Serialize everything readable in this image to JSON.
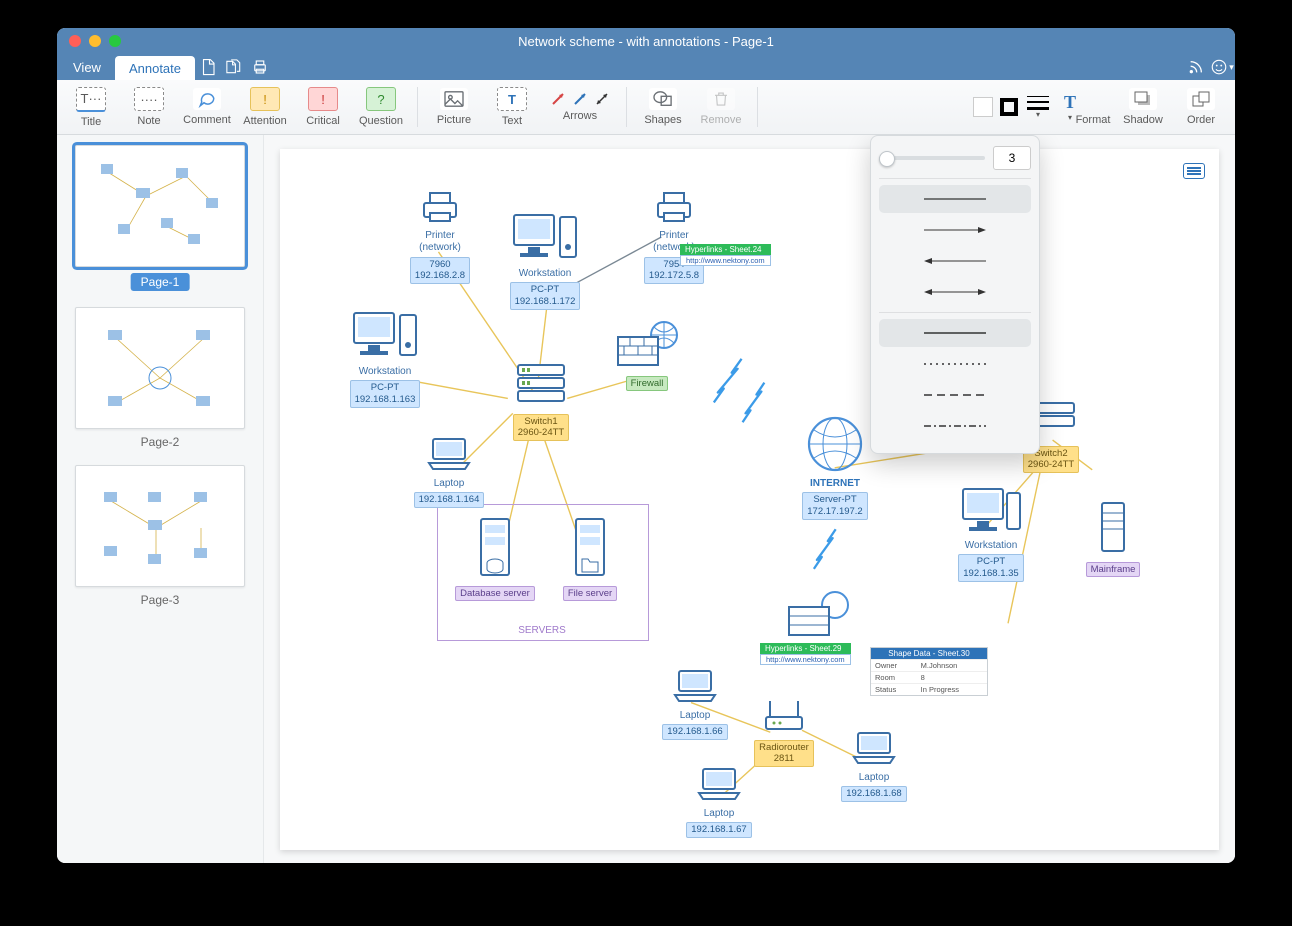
{
  "window": {
    "title": "Network scheme - with annotations - Page-1"
  },
  "menubar": {
    "view": "View",
    "annotate": "Annotate"
  },
  "toolbar": {
    "title": "Title",
    "note": "Note",
    "comment": "Comment",
    "attention": "Attention",
    "critical": "Critical",
    "question": "Question",
    "picture": "Picture",
    "text": "Text",
    "arrows": "Arrows",
    "shapes": "Shapes",
    "remove": "Remove",
    "format": "Format",
    "shadow": "Shadow",
    "order": "Order"
  },
  "sidebar": {
    "pages": [
      {
        "label": "Page-1"
      },
      {
        "label": "Page-2"
      },
      {
        "label": "Page-3"
      }
    ]
  },
  "popover": {
    "value": "3"
  },
  "diagram": {
    "printer1": {
      "name": "Printer",
      "sub": "(network)",
      "model": "7960",
      "ip": "192.168.2.8"
    },
    "printer2": {
      "name": "Printer",
      "sub": "(network)",
      "model": "7954",
      "ip": "192.172.5.8"
    },
    "workstation_main": {
      "name": "Workstation",
      "sub": "PC-PT",
      "ip": "192.168.1.172"
    },
    "workstation_left": {
      "name": "Workstation",
      "sub": "PC-PT",
      "ip": "192.168.1.163"
    },
    "workstation_right": {
      "name": "Workstation",
      "sub": "PC-PT",
      "ip": "192.168.1.35"
    },
    "laptop1": {
      "name": "Laptop",
      "ip": "192.168.1.164"
    },
    "laptop_bl1": {
      "name": "Laptop",
      "ip": "192.168.1.66"
    },
    "laptop_bl2": {
      "name": "Laptop",
      "ip": "192.168.1.67"
    },
    "laptop_br": {
      "name": "Laptop",
      "ip": "192.168.1.68"
    },
    "switch1": {
      "name": "Switch1",
      "model": "2960-24TT"
    },
    "switch2": {
      "name": "Switch2",
      "model": "2960-24TT"
    },
    "firewall1": {
      "name": "Firewall"
    },
    "firewall2": {
      "name": "Firewall"
    },
    "firewall3": {
      "name": "Firewall"
    },
    "internet": {
      "name": "INTERNET",
      "sub": "Server-PT",
      "ip": "172.17.197.2"
    },
    "dbserver": {
      "name": "Database server"
    },
    "fileserver": {
      "name": "File server"
    },
    "servers_group": "SERVERS",
    "mainframe": {
      "name": "Mainframe"
    },
    "radiorouter": {
      "name": "Radiorouter",
      "model": "2811"
    },
    "hyperlink1": {
      "title": "Hyperlinks - Sheet.24",
      "url": "http://www.nektony.com"
    },
    "hyperlink2": {
      "title": "Hyperlinks - Sheet.29",
      "url": "http://www.nektony.com"
    },
    "shapedata": {
      "title": "Shape Data - Sheet.30",
      "rows": [
        [
          "Owner",
          "M.Johnson"
        ],
        [
          "Room",
          "8"
        ],
        [
          "Status",
          "In Progress"
        ]
      ]
    }
  }
}
